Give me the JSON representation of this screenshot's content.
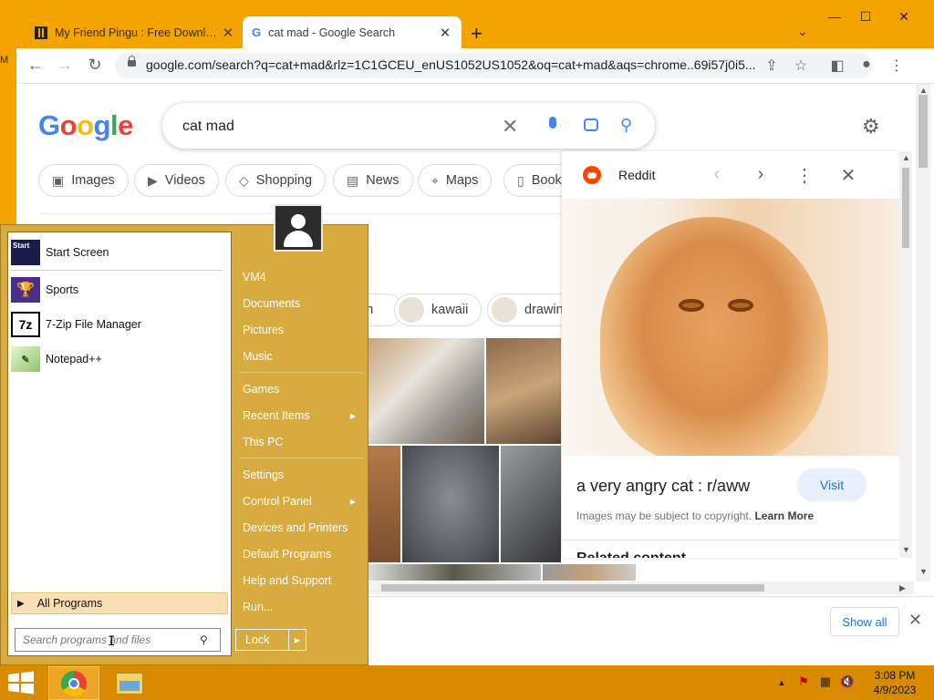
{
  "desktop": {
    "edge_label": "M"
  },
  "browser": {
    "tabs": [
      {
        "title": "My Friend Pingu : Free Download",
        "close": "✕"
      },
      {
        "title": "cat mad - Google Search",
        "close": "✕"
      }
    ],
    "new_tab": "+",
    "window_controls": {
      "minimize": "—",
      "maximize": "☐",
      "close": "✕"
    },
    "url": "google.com/search?q=cat+mad&rlz=1C1GCEU_enUS1052US1052&oq=cat+mad&aqs=chrome..69i57j0i5..."
  },
  "google": {
    "logo": [
      "G",
      "o",
      "o",
      "g",
      "l",
      "e"
    ],
    "query": "cat mad",
    "chips": [
      "Images",
      "Videos",
      "Shopping",
      "News",
      "Maps",
      "Books"
    ],
    "related_chips": [
      "cartoon",
      "kawaii",
      "drawing"
    ],
    "partial_text": "d"
  },
  "panel": {
    "source": "Reddit",
    "title": "a very angry cat : r/aww",
    "visit": "Visit",
    "copyright": "Images may be subject to copyright.",
    "learn_more": "Learn More",
    "truncated": "Related content"
  },
  "downloads": {
    "show_all": "Show all"
  },
  "start_menu": {
    "pinned": [
      {
        "label": "Start Screen",
        "icon": "start-screen"
      },
      {
        "label": "Sports",
        "icon": "trophy"
      },
      {
        "label": "7-Zip File Manager",
        "icon": "7z"
      },
      {
        "label": "Notepad++",
        "icon": "notepad"
      }
    ],
    "all_programs": "All Programs",
    "search_placeholder": "Search programs and files",
    "right": {
      "user": "VM4",
      "documents": "Documents",
      "pictures": "Pictures",
      "music": "Music",
      "games": "Games",
      "recent": "Recent Items",
      "this_pc": "This PC",
      "settings": "Settings",
      "control_panel": "Control Panel",
      "devices": "Devices and Printers",
      "default_programs": "Default Programs",
      "help": "Help and Support",
      "run": "Run..."
    },
    "lock": "Lock"
  },
  "taskbar": {
    "time": "3:08 PM",
    "date": "4/9/2023"
  },
  "colors": {
    "desktop": "#f4a400",
    "start_menu": "#d7ab3f",
    "taskbar": "#d98b00",
    "google_blue": "#4285f4"
  }
}
